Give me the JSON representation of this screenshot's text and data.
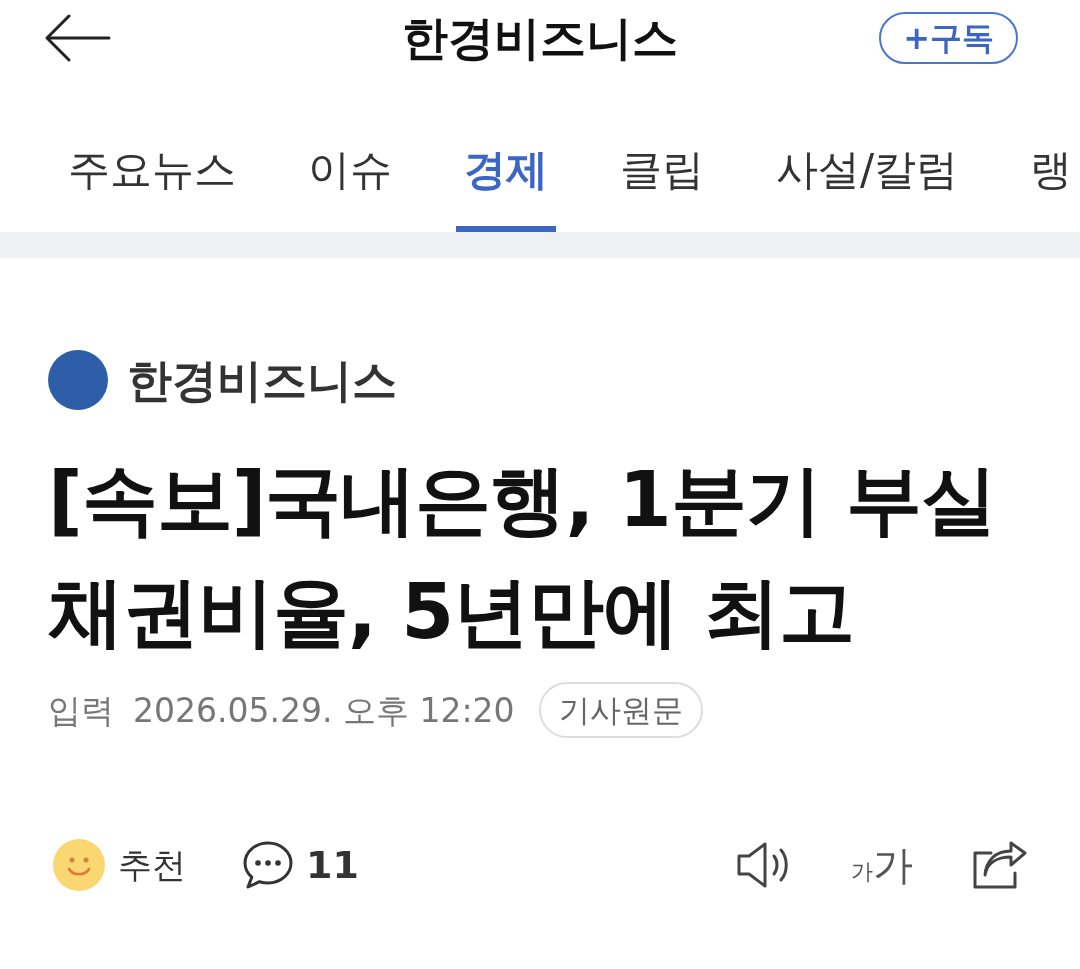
{
  "top_bar": {
    "title": "한경비즈니스",
    "subscribe_button": "+구독"
  },
  "tabs": [
    {
      "label": "주요뉴스",
      "selected": false
    },
    {
      "label": "이슈",
      "selected": false
    },
    {
      "label": "경제",
      "selected": true
    },
    {
      "label": "클립",
      "selected": false
    },
    {
      "label": "사설/칼럼",
      "selected": false
    },
    {
      "label": "랭",
      "selected": false
    }
  ],
  "article": {
    "publisher": "한경비즈니스",
    "headline": "[속보]국내은행, 1분기 부실 채권비율, 5년만에 최고",
    "input_label": "입력",
    "datetime": "2026.05.29. 오후 12:20",
    "original_link": "기사원문"
  },
  "actions": {
    "recommend_label": "추천",
    "comment_count": "11",
    "font_size": {
      "small": "가",
      "large": "가"
    }
  }
}
